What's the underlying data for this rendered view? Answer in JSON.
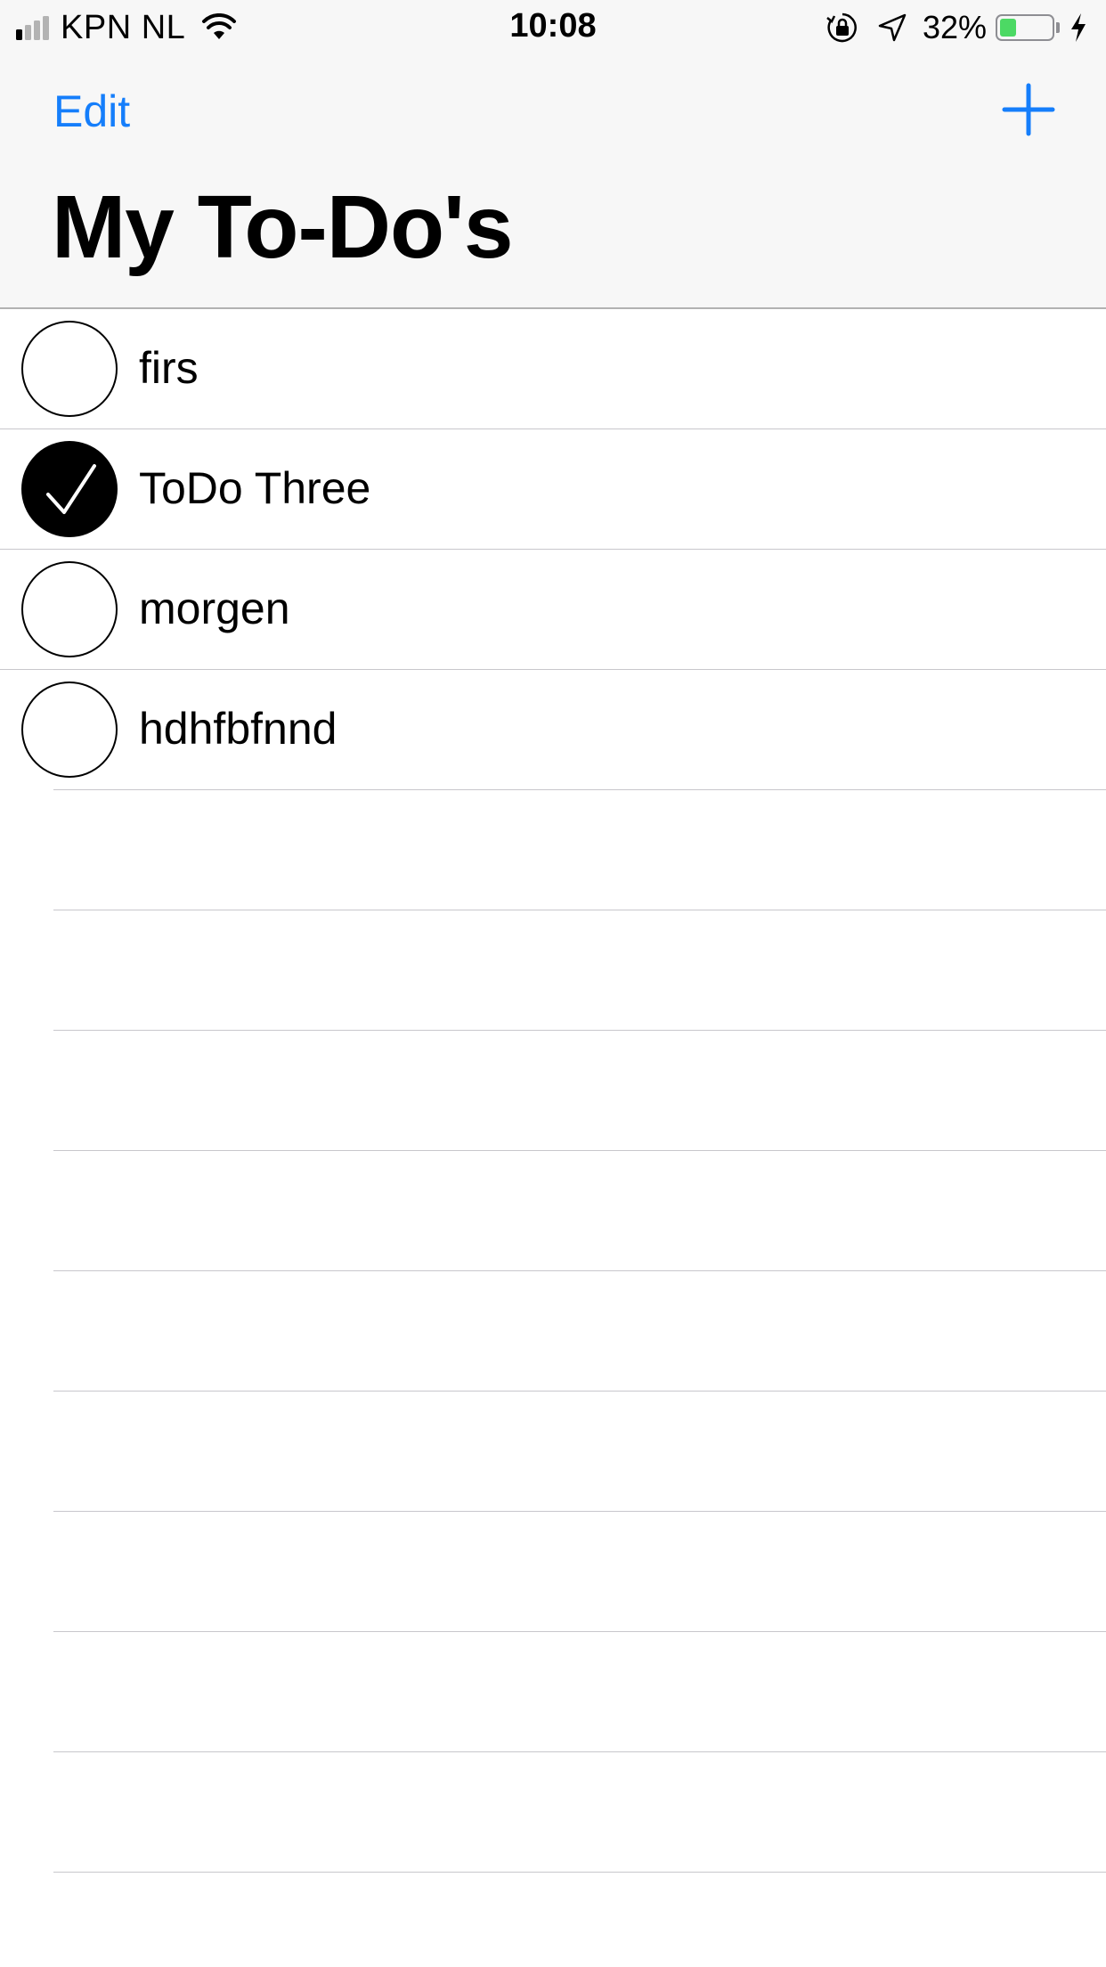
{
  "status_bar": {
    "carrier": "KPN NL",
    "time": "10:08",
    "battery_percent_text": "32%",
    "battery_level": 0.32,
    "signal_bars_active": 1,
    "signal_bars_total": 4,
    "charging": true,
    "icons": [
      "signal-icon",
      "wifi-icon",
      "orientation-lock-icon",
      "location-arrow-icon",
      "battery-icon",
      "charging-bolt-icon"
    ]
  },
  "nav": {
    "edit_label": "Edit",
    "add_icon": "plus-icon",
    "title": "My To-Do's"
  },
  "todos": [
    {
      "label": "firs",
      "done": false
    },
    {
      "label": "ToDo Three",
      "done": true
    },
    {
      "label": "morgen",
      "done": false
    },
    {
      "label": "hdhfbfnnd",
      "done": false
    }
  ],
  "colors": {
    "accent": "#157efb",
    "battery_fill": "#4cd964",
    "header_bg": "#f7f7f7",
    "separator": "#c8c7cc"
  }
}
